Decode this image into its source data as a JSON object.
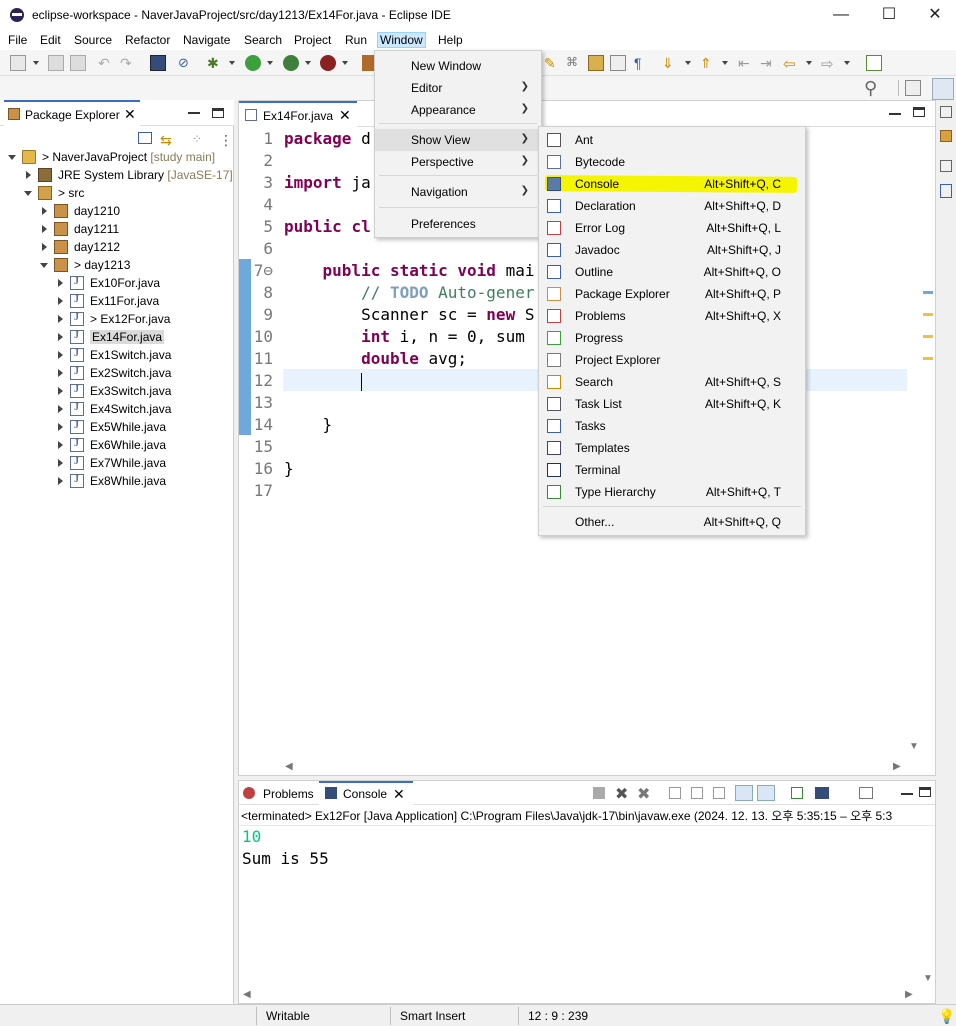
{
  "window": {
    "title": "eclipse-workspace - NaverJavaProject/src/day1213/Ex14For.java - Eclipse IDE",
    "minimize": "—",
    "maximize": "☐",
    "close": "✕"
  },
  "menubar": [
    "File",
    "Edit",
    "Source",
    "Refactor",
    "Navigate",
    "Search",
    "Project",
    "Run",
    "Window",
    "Help"
  ],
  "window_menu": {
    "items": [
      {
        "label": "New Window",
        "submenu": false
      },
      {
        "label": "Editor",
        "submenu": true
      },
      {
        "label": "Appearance",
        "submenu": true
      },
      {
        "label": "Show View",
        "submenu": true
      },
      {
        "label": "Perspective",
        "submenu": true
      },
      {
        "label": "Navigation",
        "submenu": true
      },
      {
        "label": "Preferences",
        "submenu": false
      }
    ]
  },
  "show_view_menu": {
    "items": [
      {
        "label": "Ant",
        "shortcut": "",
        "icon": "ant-icon"
      },
      {
        "label": "Bytecode",
        "shortcut": "",
        "icon": "bytecode-icon"
      },
      {
        "label": "Console",
        "shortcut": "Alt+Shift+Q, C",
        "icon": "console-icon"
      },
      {
        "label": "Declaration",
        "shortcut": "Alt+Shift+Q, D",
        "icon": "declaration-icon"
      },
      {
        "label": "Error Log",
        "shortcut": "Alt+Shift+Q, L",
        "icon": "error-log-icon"
      },
      {
        "label": "Javadoc",
        "shortcut": "Alt+Shift+Q, J",
        "icon": "javadoc-icon"
      },
      {
        "label": "Outline",
        "shortcut": "Alt+Shift+Q, O",
        "icon": "outline-icon"
      },
      {
        "label": "Package Explorer",
        "shortcut": "Alt+Shift+Q, P",
        "icon": "package-explorer-icon"
      },
      {
        "label": "Problems",
        "shortcut": "Alt+Shift+Q, X",
        "icon": "problems-icon"
      },
      {
        "label": "Progress",
        "shortcut": "",
        "icon": "progress-icon"
      },
      {
        "label": "Project Explorer",
        "shortcut": "",
        "icon": "project-explorer-icon"
      },
      {
        "label": "Search",
        "shortcut": "Alt+Shift+Q, S",
        "icon": "search-view-icon"
      },
      {
        "label": "Task List",
        "shortcut": "Alt+Shift+Q, K",
        "icon": "task-list-icon"
      },
      {
        "label": "Tasks",
        "shortcut": "",
        "icon": "tasks-icon"
      },
      {
        "label": "Templates",
        "shortcut": "",
        "icon": "templates-icon"
      },
      {
        "label": "Terminal",
        "shortcut": "",
        "icon": "terminal-icon"
      },
      {
        "label": "Type Hierarchy",
        "shortcut": "Alt+Shift+Q, T",
        "icon": "type-hierarchy-icon"
      },
      {
        "label": "Other...",
        "shortcut": "Alt+Shift+Q, Q",
        "icon": ""
      }
    ],
    "highlight_color": "#f5f500"
  },
  "package_explorer": {
    "tab_label": "Package Explorer",
    "tree": [
      {
        "label": "> NaverJavaProject",
        "suffix": "[study main]",
        "level": 0,
        "expanded": true,
        "icon": "project-icon"
      },
      {
        "label": "JRE System Library",
        "suffix": "[JavaSE-17]",
        "level": 1,
        "expanded": false,
        "icon": "library-icon"
      },
      {
        "label": "> src",
        "suffix": "",
        "level": 1,
        "expanded": true,
        "icon": "source-folder-icon"
      },
      {
        "label": "day1210",
        "suffix": "",
        "level": 2,
        "expanded": false,
        "icon": "package-icon"
      },
      {
        "label": "day1211",
        "suffix": "",
        "level": 2,
        "expanded": false,
        "icon": "package-icon"
      },
      {
        "label": "day1212",
        "suffix": "",
        "level": 2,
        "expanded": false,
        "icon": "package-icon"
      },
      {
        "label": "> day1213",
        "suffix": "",
        "level": 2,
        "expanded": true,
        "icon": "package-icon"
      },
      {
        "label": "Ex10For.java",
        "suffix": "",
        "level": 3,
        "expanded": false,
        "icon": "java-file-icon"
      },
      {
        "label": "Ex11For.java",
        "suffix": "",
        "level": 3,
        "expanded": false,
        "icon": "java-file-icon"
      },
      {
        "label": "> Ex12For.java",
        "suffix": "",
        "level": 3,
        "expanded": false,
        "icon": "java-file-icon"
      },
      {
        "label": "Ex14For.java",
        "suffix": "",
        "level": 3,
        "expanded": false,
        "icon": "java-file-icon",
        "selected": true
      },
      {
        "label": "Ex1Switch.java",
        "suffix": "",
        "level": 3,
        "expanded": false,
        "icon": "java-file-icon"
      },
      {
        "label": "Ex2Switch.java",
        "suffix": "",
        "level": 3,
        "expanded": false,
        "icon": "java-file-icon"
      },
      {
        "label": "Ex3Switch.java",
        "suffix": "",
        "level": 3,
        "expanded": false,
        "icon": "java-file-icon"
      },
      {
        "label": "Ex4Switch.java",
        "suffix": "",
        "level": 3,
        "expanded": false,
        "icon": "java-file-icon"
      },
      {
        "label": "Ex5While.java",
        "suffix": "",
        "level": 3,
        "expanded": false,
        "icon": "java-file-icon"
      },
      {
        "label": "Ex6While.java",
        "suffix": "",
        "level": 3,
        "expanded": false,
        "icon": "java-file-icon"
      },
      {
        "label": "Ex7While.java",
        "suffix": "",
        "level": 3,
        "expanded": false,
        "icon": "java-file-icon"
      },
      {
        "label": "Ex8While.java",
        "suffix": "",
        "level": 3,
        "expanded": false,
        "icon": "java-file-icon"
      }
    ]
  },
  "editor": {
    "tab_label": "Ex14For.java",
    "line_numbers": [
      "1",
      "2",
      "3",
      "4",
      "5",
      "6",
      "7⊖",
      "8",
      "9",
      "10",
      "11",
      "12",
      "13",
      "14",
      "15",
      "16",
      "17"
    ],
    "lines": [
      [
        {
          "t": "package ",
          "c": "kw"
        },
        {
          "t": "d",
          "c": ""
        }
      ],
      [],
      [
        {
          "t": "import ",
          "c": "kw"
        },
        {
          "t": "ja",
          "c": ""
        }
      ],
      [],
      [
        {
          "t": "public ",
          "c": "kw"
        },
        {
          "t": "cl",
          "c": "kw"
        }
      ],
      [],
      [
        {
          "t": "    public static void ",
          "c": "kw"
        },
        {
          "t": "mai",
          "c": ""
        }
      ],
      [
        {
          "t": "        // ",
          "c": "cm"
        },
        {
          "t": "TODO",
          "c": "todo"
        },
        {
          "t": " Auto-gener",
          "c": "cm"
        }
      ],
      [
        {
          "t": "        Scanner ",
          "c": ""
        },
        {
          "t": "sc",
          "c": ""
        },
        {
          "t": " = ",
          "c": ""
        },
        {
          "t": "new ",
          "c": "kw"
        },
        {
          "t": "S",
          "c": ""
        }
      ],
      [
        {
          "t": "        int ",
          "c": "kw"
        },
        {
          "t": "i, ",
          "c": ""
        },
        {
          "t": "n",
          "c": ""
        },
        {
          "t": " = 0, ",
          "c": ""
        },
        {
          "t": "sum",
          "c": ""
        }
      ],
      [
        {
          "t": "        double ",
          "c": "kw"
        },
        {
          "t": "avg",
          "c": ""
        },
        {
          "t": ";",
          "c": ""
        }
      ],
      [
        {
          "t": "        |",
          "c": ""
        }
      ],
      [],
      [
        {
          "t": "    }",
          "c": ""
        }
      ],
      [],
      [
        {
          "t": "}",
          "c": ""
        }
      ],
      []
    ]
  },
  "console_view": {
    "tab_problems": "Problems",
    "tab_console": "Console",
    "terminated_line": "<terminated> Ex12For [Java Application] C:\\Program Files\\Java\\jdk-17\\bin\\javaw.exe  (2024. 12. 13. 오후 5:35:15 – 오후 5:3",
    "output_input": "10",
    "output_text": "Sum is 55",
    "input_color": "#00c87d"
  },
  "status_bar": {
    "writable": "Writable",
    "insert_mode": "Smart Insert",
    "position": "12 : 9 : 239"
  }
}
